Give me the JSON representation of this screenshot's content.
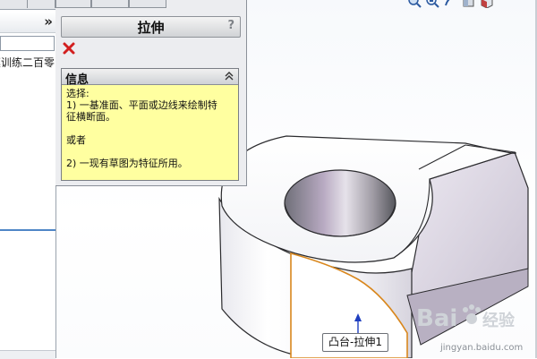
{
  "tree": {
    "root_label": "莫训练二百零",
    "collapse_glyph": "»"
  },
  "property_manager": {
    "title": "拉伸",
    "help_glyph": "?",
    "message": {
      "title": "信息",
      "line1": "选择:",
      "line2": "1) 一基准面、平面或边线来绘制特",
      "line3": "征横断面。",
      "line4": "或者",
      "line5": "2) 一现有草图为特征所用。"
    }
  },
  "graphics": {
    "callout": "凸台-拉伸1",
    "edge_highlight_color": "#d9871d",
    "arrow_color": "#1f3fbf"
  },
  "watermark": {
    "brand": "Bai",
    "brand_cn": "经验",
    "url": "jingyan.baidu.com"
  },
  "icons": [
    "zoom-to-fit-icon",
    "zoom-area-icon",
    "previous-view-icon",
    "section-view-icon",
    "view-orientation-icon",
    "close-icon",
    "collapse-icon"
  ]
}
